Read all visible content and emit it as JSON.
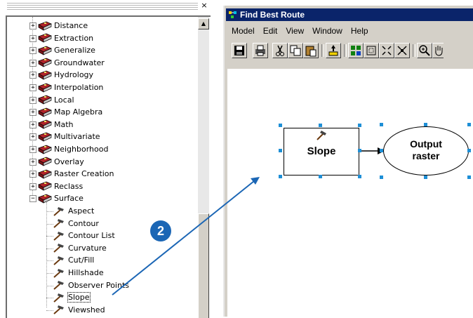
{
  "tree": {
    "close_glyph": "×",
    "scroll_up_glyph": "▲",
    "toolsets": [
      {
        "label": "Distance",
        "expander": "+"
      },
      {
        "label": "Extraction",
        "expander": "+"
      },
      {
        "label": "Generalize",
        "expander": "+"
      },
      {
        "label": "Groundwater",
        "expander": "+"
      },
      {
        "label": "Hydrology",
        "expander": "+"
      },
      {
        "label": "Interpolation",
        "expander": "+"
      },
      {
        "label": "Local",
        "expander": "+"
      },
      {
        "label": "Map Algebra",
        "expander": "+"
      },
      {
        "label": "Math",
        "expander": "+"
      },
      {
        "label": "Multivariate",
        "expander": "+"
      },
      {
        "label": "Neighborhood",
        "expander": "+"
      },
      {
        "label": "Overlay",
        "expander": "+"
      },
      {
        "label": "Raster Creation",
        "expander": "+"
      },
      {
        "label": "Reclass",
        "expander": "+"
      },
      {
        "label": "Surface",
        "expander": "−"
      }
    ],
    "surface_tools": [
      {
        "label": "Aspect"
      },
      {
        "label": "Contour"
      },
      {
        "label": "Contour List"
      },
      {
        "label": "Curvature"
      },
      {
        "label": "Cut/Fill"
      },
      {
        "label": "Hillshade"
      },
      {
        "label": "Observer Points"
      },
      {
        "label": "Slope",
        "selected": true
      },
      {
        "label": "Viewshed"
      }
    ]
  },
  "window": {
    "title": "Find Best Route",
    "menus": [
      "Model",
      "Edit",
      "View",
      "Window",
      "Help"
    ]
  },
  "model": {
    "tool_label": "Slope",
    "output_label": "Output\nraster"
  },
  "annotation": {
    "step_number": "2"
  },
  "colors": {
    "title_bar": "#0a246a",
    "selection_handle": "#1e8fd6",
    "annotation_blue": "#1b66b5",
    "toolbox_red": "#b0242a"
  }
}
